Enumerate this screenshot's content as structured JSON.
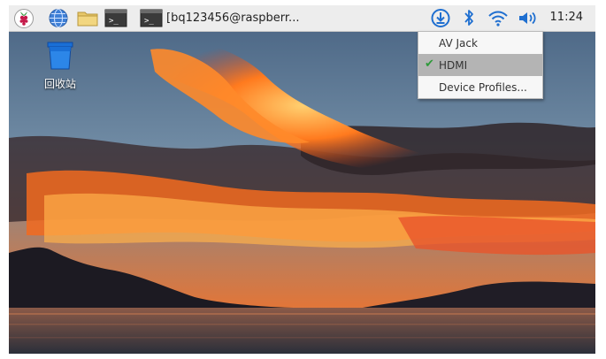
{
  "taskbar": {
    "window_title": "[bq123456@raspberr...",
    "clock": "11:24",
    "terminal_glyph": ">_"
  },
  "desktop": {
    "trash_label": "回收站"
  },
  "audio_menu": {
    "items": [
      {
        "label": "AV Jack",
        "checked": false
      },
      {
        "label": "HDMI",
        "checked": true
      },
      {
        "label": "Device Profiles..."
      }
    ],
    "check_glyph": "✔"
  },
  "colors": {
    "raspberry_red": "#c51a4a",
    "accent_blue": "#1f6fd0",
    "check_green": "#2e9a3a"
  }
}
